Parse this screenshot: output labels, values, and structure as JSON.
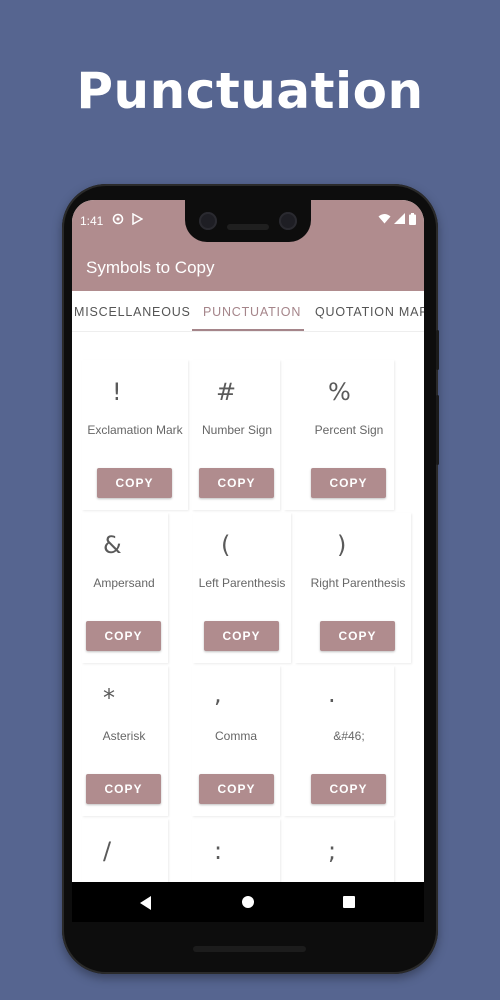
{
  "headline": "Punctuation",
  "status_bar": {
    "time": "1:41",
    "icons": [
      "sync-icon",
      "play-store-icon",
      "wifi-icon",
      "signal-icon",
      "battery-icon"
    ]
  },
  "app_bar": {
    "title": "Symbols to Copy"
  },
  "tabs": [
    {
      "label": "MISCELLANEOUS",
      "active": false
    },
    {
      "label": "PUNCTUATION",
      "active": true
    },
    {
      "label": "QUOTATION MARI",
      "active": false
    }
  ],
  "symbols": [
    {
      "symbol": "!",
      "name": "Exclamation Mark",
      "button": "COPY"
    },
    {
      "symbol": "#",
      "name": "Number Sign",
      "button": "COPY"
    },
    {
      "symbol": "%",
      "name": "Percent Sign",
      "button": "COPY"
    },
    {
      "symbol": "&",
      "name": "Ampersand",
      "button": "COPY"
    },
    {
      "symbol": "(",
      "name": "Left Parenthesis",
      "button": "COPY"
    },
    {
      "symbol": ")",
      "name": "Right Parenthesis",
      "button": "COPY"
    },
    {
      "symbol": "*",
      "name": "Asterisk",
      "button": "COPY"
    },
    {
      "symbol": ",",
      "name": "Comma",
      "button": "COPY"
    },
    {
      "symbol": ".",
      "name": "&#46;",
      "button": "COPY"
    },
    {
      "symbol": "/",
      "name": "",
      "button": ""
    },
    {
      "symbol": ":",
      "name": "",
      "button": ""
    },
    {
      "symbol": ";",
      "name": "",
      "button": ""
    }
  ],
  "nav_bar": {
    "icons": [
      "back-icon",
      "home-icon",
      "recents-icon"
    ]
  },
  "colors": {
    "background": "#566590",
    "accent": "#b08c8e",
    "tab_active": "#a5858a"
  }
}
